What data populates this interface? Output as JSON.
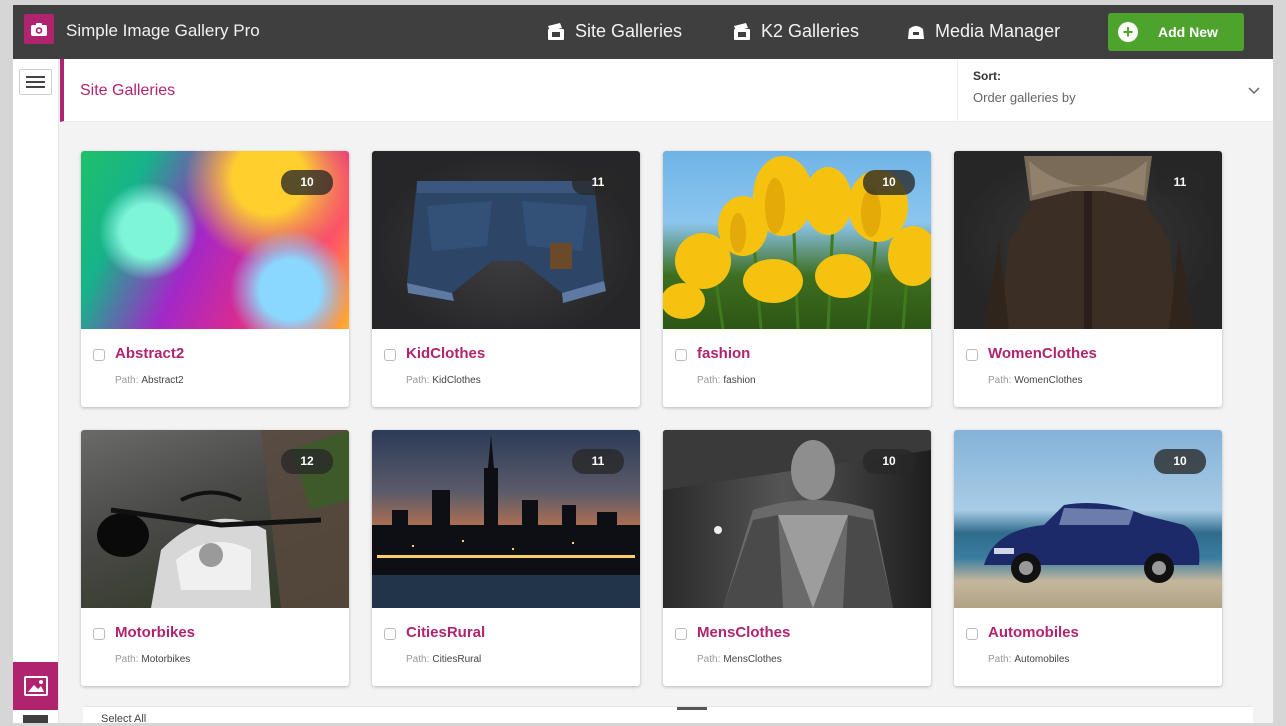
{
  "app": {
    "title": "Simple Image Gallery Pro"
  },
  "nav": [
    {
      "label": "Site Galleries",
      "icon": "gallery-stack-icon"
    },
    {
      "label": "K2 Galleries",
      "icon": "gallery-stack-icon"
    },
    {
      "label": "Media Manager",
      "icon": "media-manager-icon"
    }
  ],
  "add_button": {
    "label": "Add New",
    "color": "#4ea32d"
  },
  "page": {
    "title": "Site Galleries"
  },
  "sort": {
    "label": "Sort:",
    "value": "Order galleries by"
  },
  "galleries": [
    {
      "name": "Abstract2",
      "path_label": "Path:",
      "path": "Abstract2",
      "count": "10"
    },
    {
      "name": "KidClothes",
      "path_label": "Path:",
      "path": "KidClothes",
      "count": "11"
    },
    {
      "name": "fashion",
      "path_label": "Path:",
      "path": "fashion",
      "count": "10"
    },
    {
      "name": "WomenClothes",
      "path_label": "Path:",
      "path": "WomenClothes",
      "count": "11"
    },
    {
      "name": "Motorbikes",
      "path_label": "Path:",
      "path": "Motorbikes",
      "count": "12"
    },
    {
      "name": "CitiesRural",
      "path_label": "Path:",
      "path": "CitiesRural",
      "count": "11"
    },
    {
      "name": "MensClothes",
      "path_label": "Path:",
      "path": "MensClothes",
      "count": "10"
    },
    {
      "name": "Automobiles",
      "path_label": "Path:",
      "path": "Automobiles",
      "count": "10"
    }
  ],
  "footer": {
    "select_all": "Select All"
  },
  "colors": {
    "accent": "#b0246f",
    "topbar": "#3f3f3f",
    "add": "#4ea32d"
  }
}
